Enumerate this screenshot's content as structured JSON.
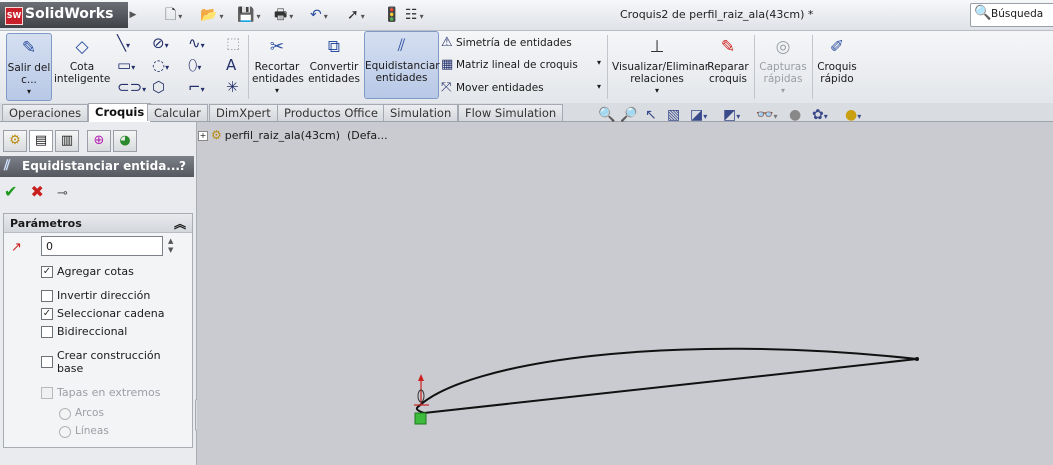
{
  "app": {
    "name": "SolidWorks",
    "logo_badge": "SW"
  },
  "quick_access": {
    "icons": [
      "new-icon",
      "open-icon",
      "save-icon",
      "print-icon",
      "undo-icon",
      "select-icon",
      "rebuild-icon",
      "options-icon"
    ]
  },
  "window_title": "Croquis2 de perfil_raiz_ala(43cm) *",
  "search": {
    "label": "Búsqueda"
  },
  "commands": {
    "exit_sketch": "Salir del c...",
    "smart_dim": "Cota inteligente",
    "trim": "Recortar entidades",
    "convert": "Convertir entidades",
    "offset": "Equidistanciar entidades",
    "mirror": "Simetría de entidades",
    "linear_pattern": "Matriz lineal de croquis",
    "move": "Mover entidades",
    "display_relations": "Visualizar/Eliminar relaciones",
    "repair": "Reparar croquis",
    "quick_snaps": "Capturas rápidas",
    "rapid_sketch": "Croquis rápido"
  },
  "tabs": [
    "Operaciones",
    "Croquis",
    "Calcular",
    "DimXpert",
    "Productos Office",
    "Simulation",
    "Flow Simulation"
  ],
  "active_tab": "Croquis",
  "tree": {
    "item": "perfil_raiz_ala(43cm)",
    "suffix": "(Defa..."
  },
  "property_manager": {
    "title": "Equidistanciar entida...",
    "help": "?",
    "section": "Parámetros",
    "distance_value": "0",
    "options": [
      {
        "label": "Agregar cotas",
        "checked": true,
        "enabled": true
      },
      {
        "label": "Invertir dirección",
        "checked": false,
        "enabled": true
      },
      {
        "label": "Seleccionar cadena",
        "checked": true,
        "enabled": true
      },
      {
        "label": "Bidireccional",
        "checked": false,
        "enabled": true
      },
      {
        "label": "Crear construcción base",
        "checked": false,
        "enabled": true
      },
      {
        "label": "Tapas en extremos",
        "checked": false,
        "enabled": false
      }
    ],
    "cap_types": [
      "Arcos",
      "Líneas"
    ]
  }
}
